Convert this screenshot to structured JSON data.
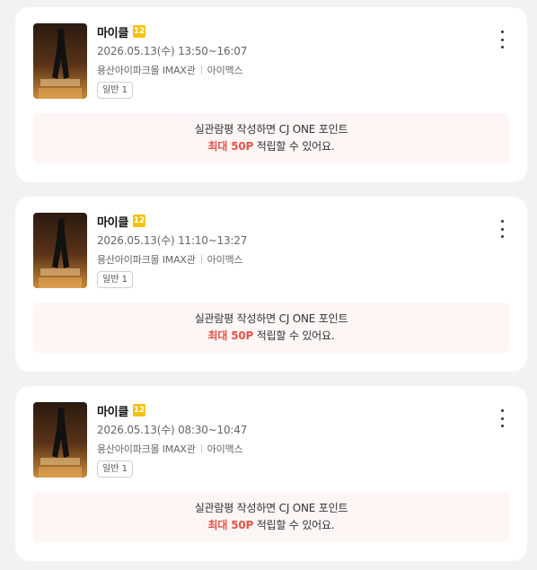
{
  "bookings": [
    {
      "title": "마이클",
      "rating": "12",
      "datetime": "2026.05.13(수) 13:50~16:07",
      "theater": "용산아이파크몰 IMAX관",
      "format": "아이맥스",
      "seat": "일반 1",
      "promo": {
        "line1": "실관람평 작성하면 CJ ONE 포인트",
        "highlight": "최대 50P",
        "line2_suffix": " 적립할 수 있어요."
      }
    },
    {
      "title": "마이클",
      "rating": "12",
      "datetime": "2026.05.13(수) 11:10~13:27",
      "theater": "용산아이파크몰 IMAX관",
      "format": "아이맥스",
      "seat": "일반 1",
      "promo": {
        "line1": "실관람평 작성하면 CJ ONE 포인트",
        "highlight": "최대 50P",
        "line2_suffix": " 적립할 수 있어요."
      }
    },
    {
      "title": "마이클",
      "rating": "12",
      "datetime": "2026.05.13(수) 08:30~10:47",
      "theater": "용산아이파크몰 IMAX관",
      "format": "아이맥스",
      "seat": "일반 1",
      "promo": {
        "line1": "실관람평 작성하면 CJ ONE 포인트",
        "highlight": "최대 50P",
        "line2_suffix": " 적립할 수 있어요."
      }
    }
  ],
  "colors": {
    "accent": "#e8534a",
    "rating_badge": "#f4c20d",
    "promo_bg": "#fdf6f4"
  },
  "icons": {
    "more": "more-vertical-icon"
  }
}
